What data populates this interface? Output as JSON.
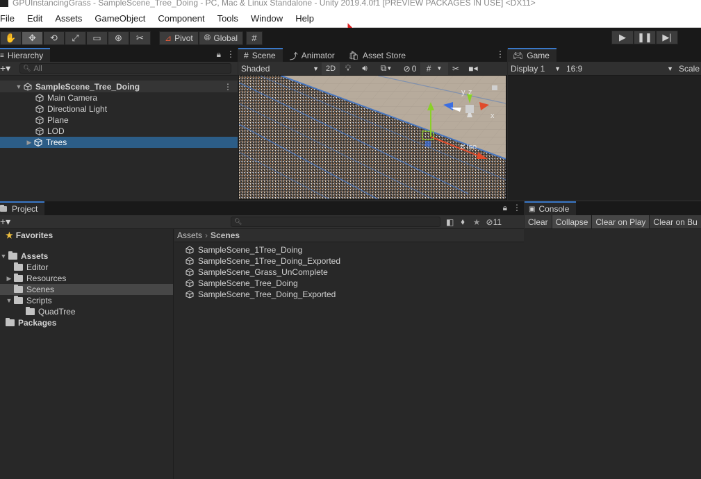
{
  "window": {
    "title": "GPUInstancingGrass - SampleScene_Tree_Doing - PC, Mac & Linux Standalone - Unity 2019.4.0f1 [PREVIEW PACKAGES IN USE] <DX11>"
  },
  "menu": [
    "File",
    "Edit",
    "Assets",
    "GameObject",
    "Component",
    "Tools",
    "Window",
    "Help"
  ],
  "toolbar": {
    "tools": [
      "hand-tool",
      "move-tool",
      "rotate-tool",
      "scale-tool",
      "rect-tool",
      "transform-tool",
      "custom-tool"
    ],
    "pivot_label": "Pivot",
    "global_label": "Global",
    "play": [
      "play-icon",
      "pause-icon",
      "step-icon"
    ]
  },
  "hierarchy": {
    "tab_label": "Hierarchy",
    "search_placeholder": "All",
    "scene_name": "SampleScene_Tree_Doing",
    "items": [
      "Main Camera",
      "Directional Light",
      "Plane",
      "LOD",
      "Trees"
    ],
    "selected": "Trees"
  },
  "scene_view": {
    "tabs": [
      "Scene",
      "Animator",
      "Asset Store"
    ],
    "shading_mode": "Shaded",
    "mode_2d": "2D",
    "hidden_count": "0",
    "gizmo_axes": [
      "y",
      "z",
      "x"
    ],
    "projection_label": "Iso"
  },
  "game_view": {
    "tab_label": "Game",
    "display": "Display 1",
    "aspect": "16:9",
    "scale_label": "Scale"
  },
  "project": {
    "tab_label": "Project",
    "hidden_count": "11",
    "favorites_label": "Favorites",
    "tree": [
      {
        "label": "Assets",
        "bold": true
      },
      {
        "label": "Editor"
      },
      {
        "label": "Resources"
      },
      {
        "label": "Scenes"
      },
      {
        "label": "Scripts"
      },
      {
        "label": "QuadTree"
      },
      {
        "label": "Packages",
        "bold": true
      }
    ],
    "breadcrumb": [
      "Assets",
      "Scenes"
    ],
    "assets": [
      "SampleScene_1Tree_Doing",
      "SampleScene_1Tree_Doing_Exported",
      "SampleScene_Grass_UnComplete",
      "SampleScene_Tree_Doing",
      "SampleScene_Tree_Doing_Exported"
    ]
  },
  "console": {
    "tab_label": "Console",
    "buttons": [
      "Clear",
      "Collapse",
      "Clear on Play",
      "Clear on Bu"
    ]
  },
  "colors": {
    "selection": "#2c5d87",
    "panel_bg": "#282828",
    "tab_accent": "#3a78c8",
    "scene_ground": "#b7ab9c",
    "grass_plane_edge": "#4a78c0"
  }
}
